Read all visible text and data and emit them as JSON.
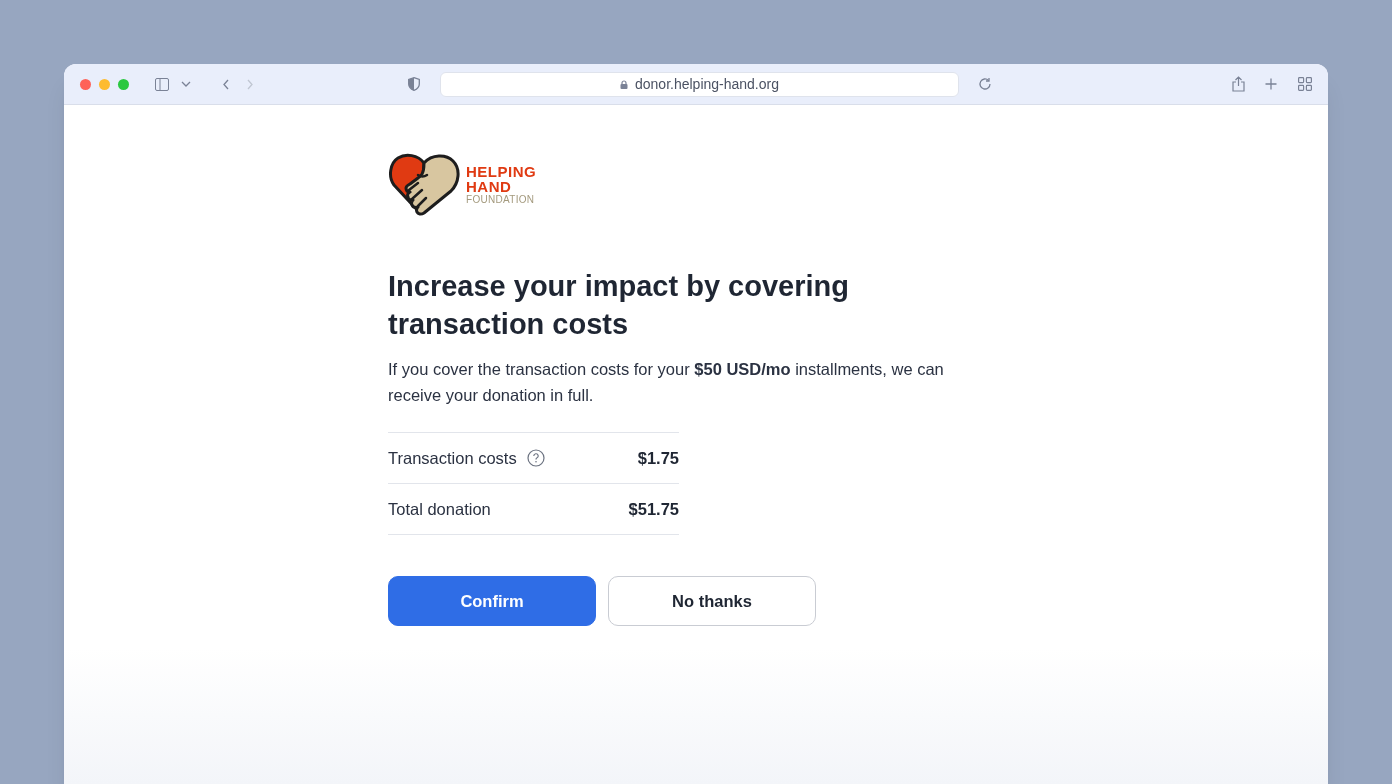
{
  "browser": {
    "url": "donor.helping-hand.org"
  },
  "logo": {
    "lines": [
      "HELPING",
      "HAND",
      "FOUNDATION"
    ]
  },
  "heading": "Increase your impact by covering transaction costs",
  "description": "If you cover the transaction costs for your **$50 USD/mo** installments, we can receive your donation in full.",
  "summary": [
    {
      "label": "Transaction costs",
      "help": true,
      "amount": "$1.75"
    },
    {
      "label": "Total donation",
      "help": false,
      "amount": "$51.75"
    }
  ],
  "buttons": [
    {
      "label": "Confirm",
      "kind": "primary"
    },
    {
      "label": "No thanks",
      "kind": "secondary"
    }
  ]
}
